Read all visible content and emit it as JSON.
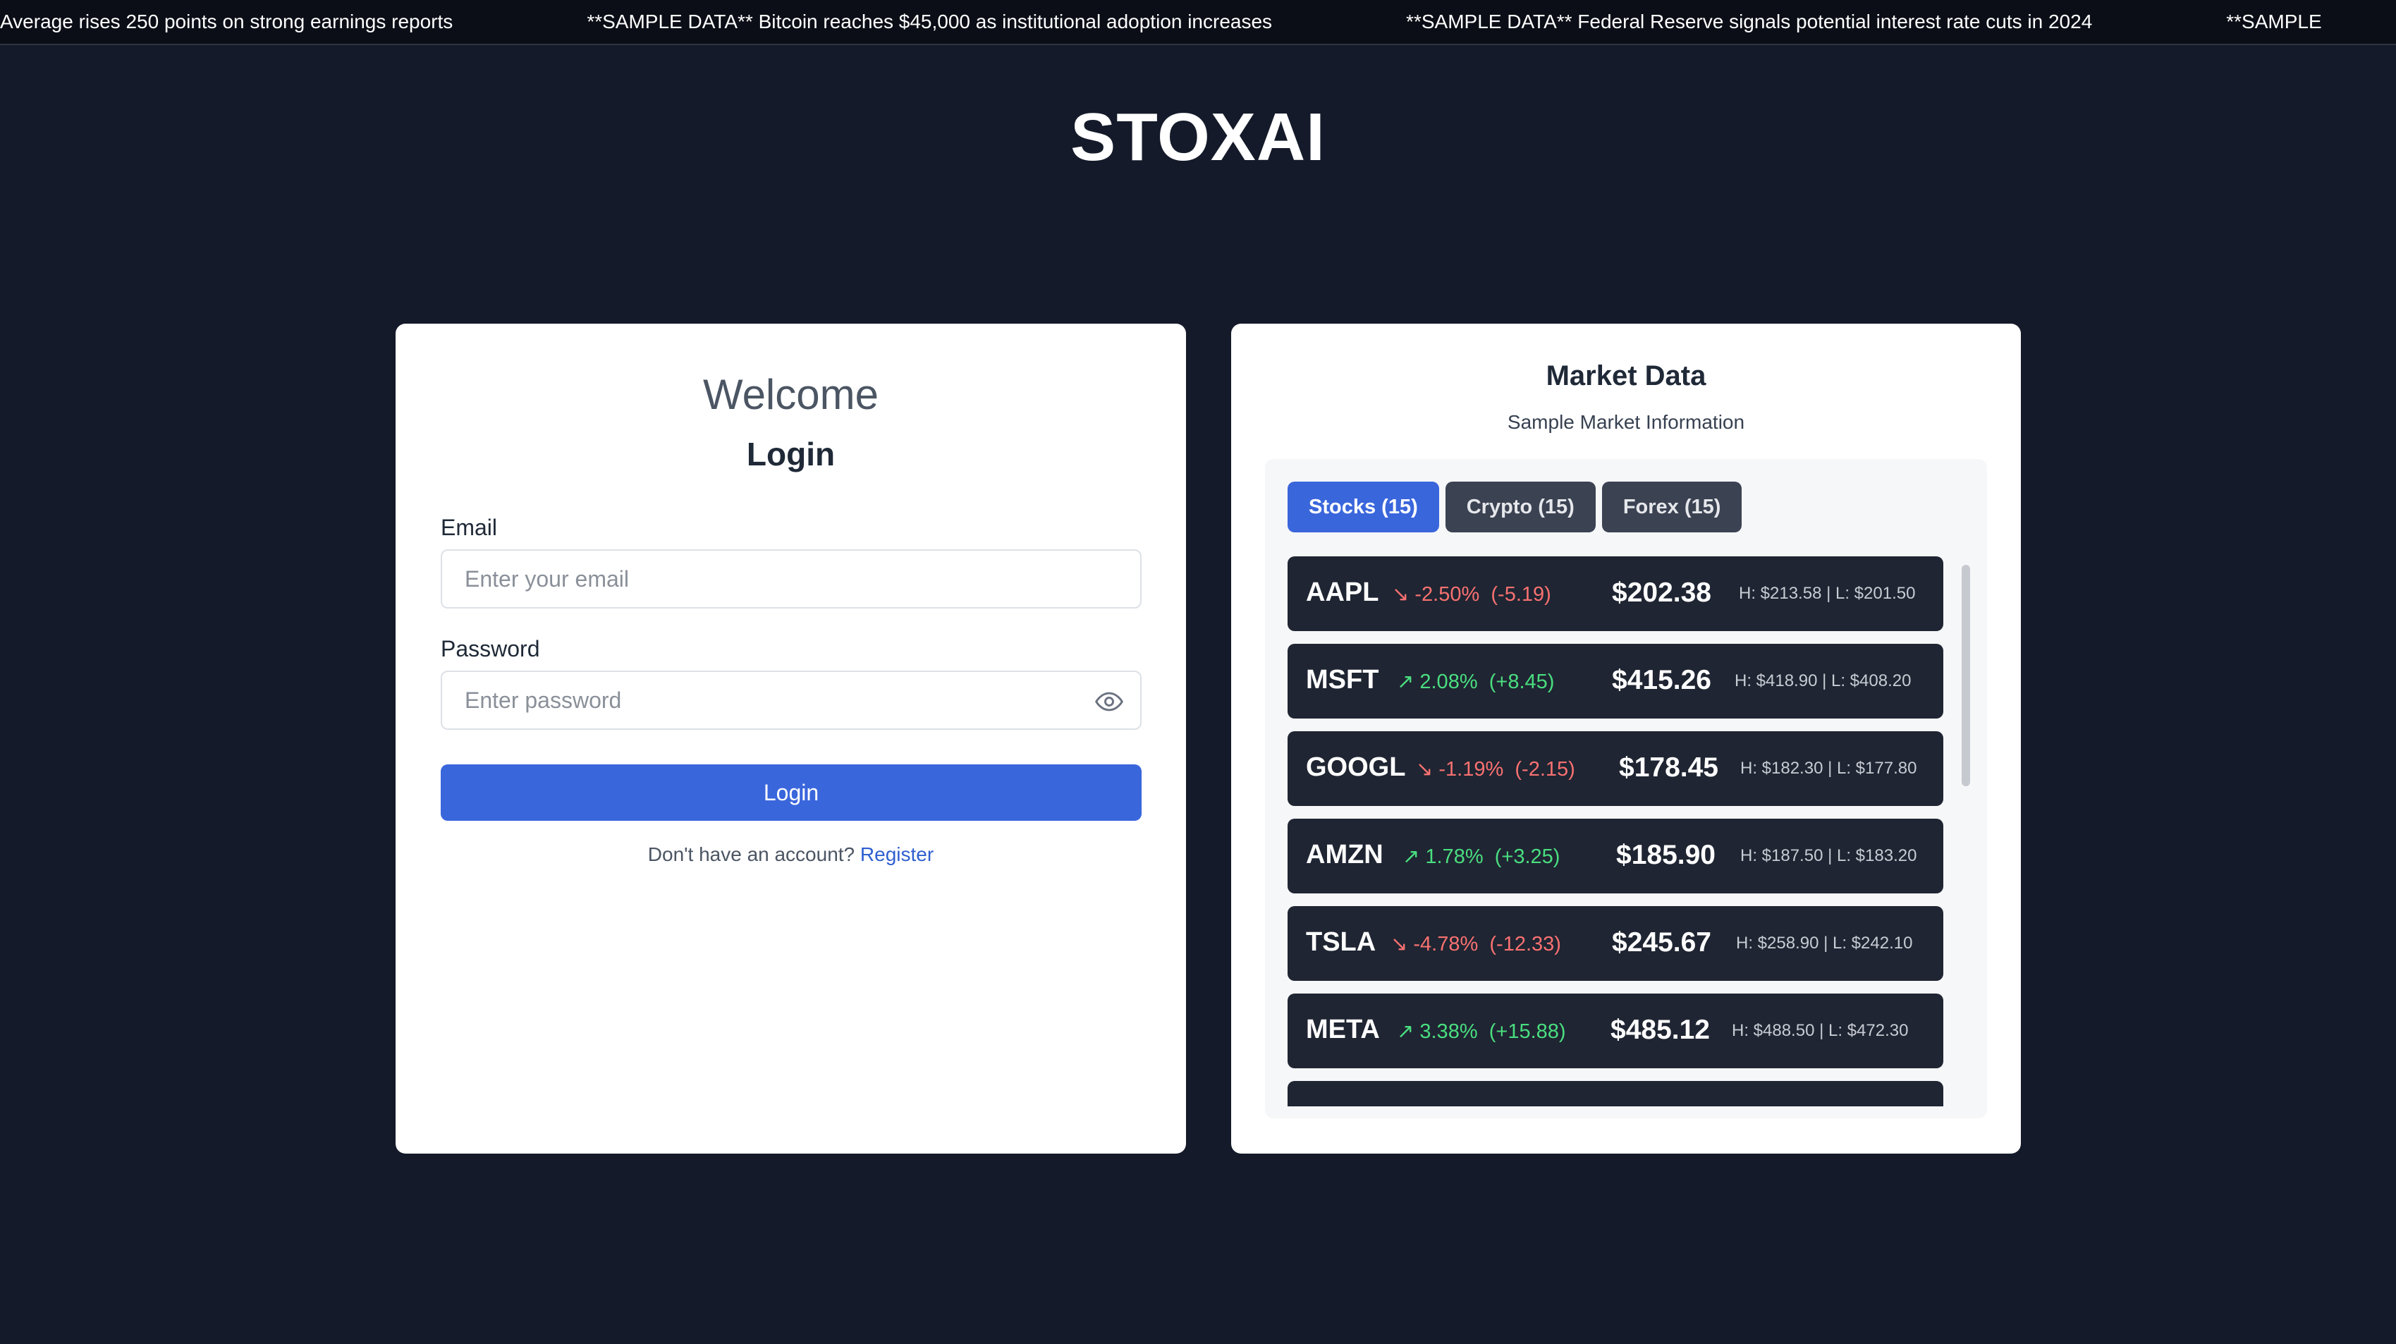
{
  "ticker": {
    "items": [
      "Average rises 250 points on strong earnings reports",
      "**SAMPLE DATA** Bitcoin reaches $45,000 as institutional adoption increases",
      "**SAMPLE DATA** Federal Reserve signals potential interest rate cuts in 2024",
      "**SAMPLE"
    ]
  },
  "brand": {
    "title": "STOXAI"
  },
  "login": {
    "welcome": "Welcome",
    "heading": "Login",
    "email_label": "Email",
    "email_placeholder": "Enter your email",
    "email_value": "",
    "password_label": "Password",
    "password_placeholder": "Enter password",
    "password_value": "",
    "submit_label": "Login",
    "register_prompt": "Don't have an account?",
    "register_link": "Register"
  },
  "market": {
    "title": "Market Data",
    "subtitle": "Sample Market Information",
    "tabs": [
      {
        "label": "Stocks (15)",
        "active": true
      },
      {
        "label": "Crypto (15)",
        "active": false
      },
      {
        "label": "Forex (15)",
        "active": false
      }
    ],
    "rows": [
      {
        "symbol": "AAPL",
        "direction": "down",
        "arrow": "↘",
        "percent": "-2.50%",
        "change": "(-5.19)",
        "price": "$202.38",
        "high_low": "H: $213.58 | L: $201.50"
      },
      {
        "symbol": "MSFT",
        "direction": "up",
        "arrow": "↗",
        "percent": "2.08%",
        "change": "(+8.45)",
        "price": "$415.26",
        "high_low": "H: $418.90 | L: $408.20"
      },
      {
        "symbol": "GOOGL",
        "direction": "down",
        "arrow": "↘",
        "percent": "-1.19%",
        "change": "(-2.15)",
        "price": "$178.45",
        "high_low": "H: $182.30 | L: $177.80"
      },
      {
        "symbol": "AMZN",
        "direction": "up",
        "arrow": "↗",
        "percent": "1.78%",
        "change": "(+3.25)",
        "price": "$185.90",
        "high_low": "H: $187.50 | L: $183.20"
      },
      {
        "symbol": "TSLA",
        "direction": "down",
        "arrow": "↘",
        "percent": "-4.78%",
        "change": "(-12.33)",
        "price": "$245.67",
        "high_low": "H: $258.90 | L: $242.10"
      },
      {
        "symbol": "META",
        "direction": "up",
        "arrow": "↗",
        "percent": "3.38%",
        "change": "(+15.88)",
        "price": "$485.12",
        "high_low": "H: $488.50 | L: $472.30"
      }
    ]
  },
  "colors": {
    "background": "#141a29",
    "accent": "#3a66dc",
    "up": "#4ade80",
    "down": "#f87171",
    "row_bg": "#1f2532"
  }
}
